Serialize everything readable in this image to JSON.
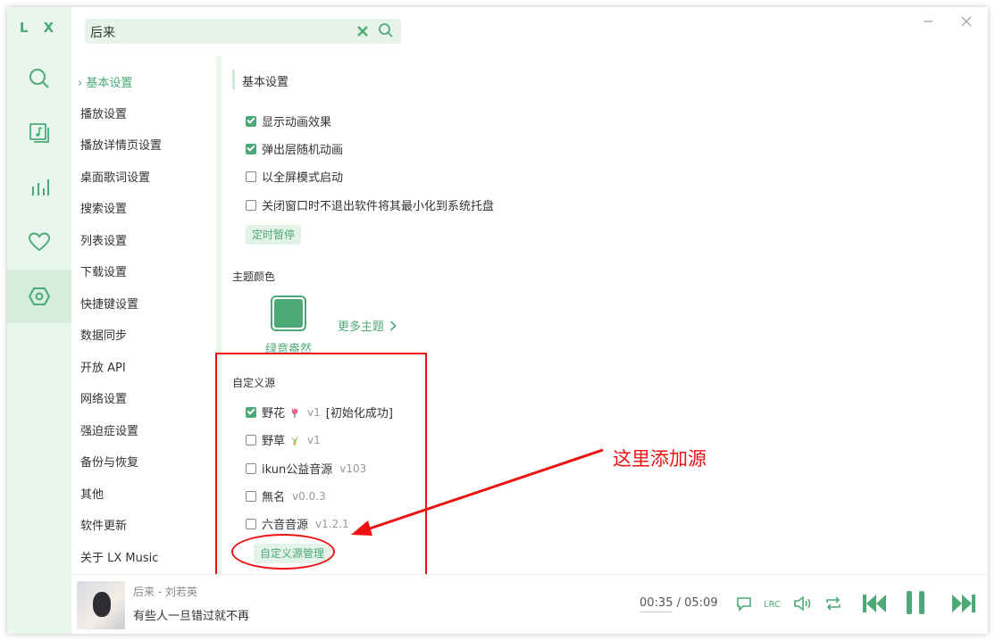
{
  "app": {
    "logo": "L X"
  },
  "rail": [
    {
      "icon": "search-icon"
    },
    {
      "icon": "music-library-icon"
    },
    {
      "icon": "leaderboard-icon"
    },
    {
      "icon": "heart-icon"
    },
    {
      "icon": "settings-icon",
      "active": true
    }
  ],
  "search": {
    "value": "后来"
  },
  "nav": {
    "active_marker": "›",
    "items": [
      "基本设置",
      "播放设置",
      "播放详情页设置",
      "桌面歌词设置",
      "搜索设置",
      "列表设置",
      "下载设置",
      "快捷键设置",
      "数据同步",
      "开放 API",
      "网络设置",
      "强迫症设置",
      "备份与恢复",
      "其他",
      "软件更新",
      "关于 LX Music"
    ]
  },
  "basic": {
    "title": "基本设置",
    "options": [
      {
        "label": "显示动画效果",
        "checked": true
      },
      {
        "label": "弹出层随机动画",
        "checked": true
      },
      {
        "label": "以全屏模式启动",
        "checked": false
      },
      {
        "label": "关闭窗口时不退出软件将其最小化到系统托盘",
        "checked": false
      }
    ],
    "timer_button": "定时暂停"
  },
  "theme": {
    "title": "主题颜色",
    "current": "绿意盎然",
    "color": "#4daa77",
    "more": "更多主题"
  },
  "sources": {
    "title": "自定义源",
    "items": [
      {
        "name": "野花",
        "icon": "tulip-icon",
        "version": "v1",
        "status": "[初始化成功]",
        "checked": true
      },
      {
        "name": "野草",
        "icon": "herb-icon",
        "version": "v1",
        "status": "",
        "checked": false
      },
      {
        "name": "ikun公益音源",
        "icon": "",
        "version": "v103",
        "status": "",
        "checked": false
      },
      {
        "name": "無名",
        "icon": "",
        "version": "v0.0.3",
        "status": "",
        "checked": false
      },
      {
        "name": "六音音源",
        "icon": "",
        "version": "v1.2.1",
        "status": "",
        "checked": false
      }
    ],
    "manage_button": "自定义源管理"
  },
  "annotation": {
    "text": "这里添加源",
    "color": "#ee1111"
  },
  "player": {
    "song": "后来 - 刘若英",
    "lyric": "有些人一旦错过就不再",
    "current_time": "00:35",
    "separator": "/",
    "duration": "05:09",
    "controls": [
      "comment-icon",
      "lyric-icon",
      "volume-icon",
      "repeat-icon",
      "previous-icon",
      "pause-icon",
      "next-icon"
    ]
  },
  "colors": {
    "accent": "#4daa77",
    "rail_bg": "#e9f6ee",
    "highlight": "#ee1111"
  }
}
